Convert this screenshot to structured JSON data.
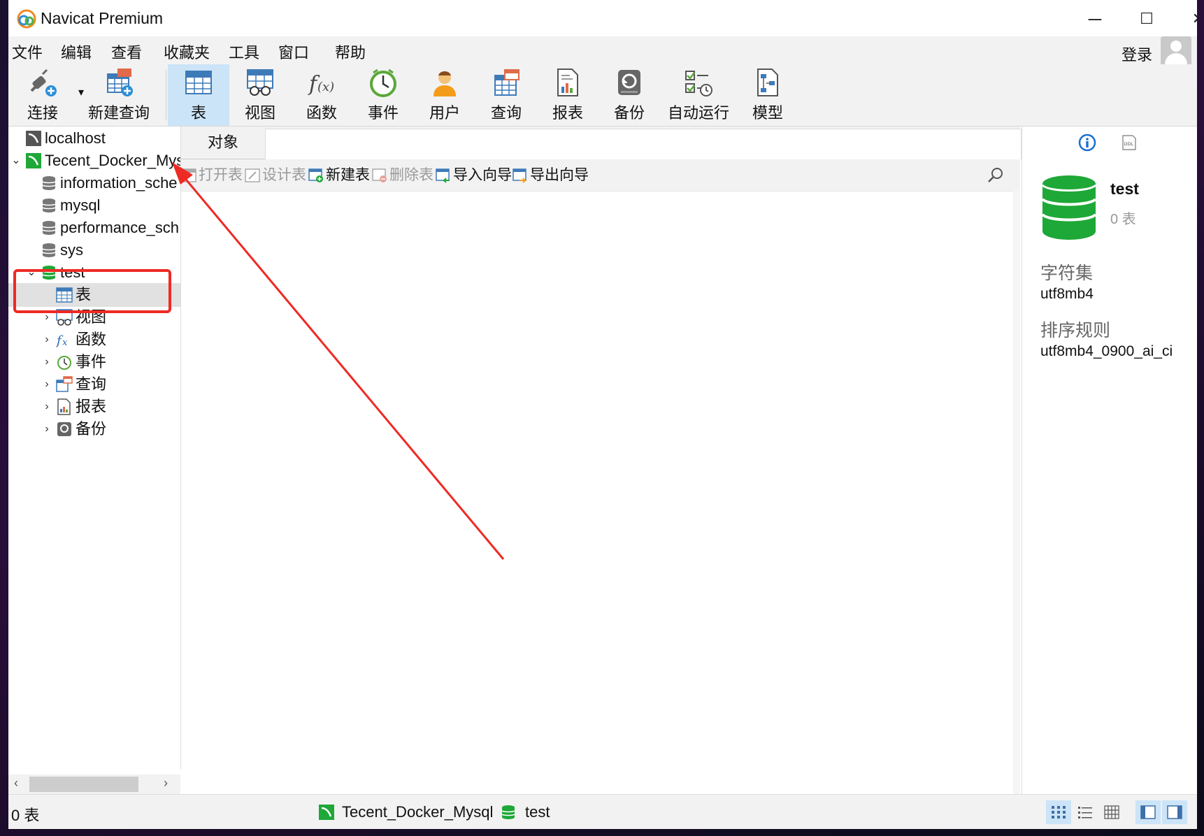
{
  "window": {
    "title": "Navicat Premium",
    "controls": {
      "minimize": "─",
      "maximize": "☐",
      "close": "✕"
    }
  },
  "menubar": {
    "items": [
      "文件",
      "编辑",
      "查看",
      "收藏夹",
      "工具",
      "窗口",
      "帮助"
    ],
    "login": "登录"
  },
  "toolbar": {
    "connect": "连接",
    "new_query": "新建查询",
    "buttons": [
      "表",
      "视图",
      "函数",
      "事件",
      "用户",
      "查询",
      "报表",
      "备份",
      "自动运行",
      "模型"
    ],
    "active": "表"
  },
  "sidebar": {
    "localhost": "localhost",
    "connection": "Tecent_Docker_Mys",
    "databases": [
      "information_sche",
      "mysql",
      "performance_sch",
      "sys"
    ],
    "open_db": "test",
    "children": [
      "表",
      "视图",
      "函数",
      "事件",
      "查询",
      "报表",
      "备份"
    ]
  },
  "main": {
    "tab": "对象",
    "actions": [
      "打开表",
      "设计表",
      "新建表",
      "删除表",
      "导入向导",
      "导出向导"
    ]
  },
  "info_panel": {
    "db_name": "test",
    "table_count": "0 表",
    "charset_label": "字符集",
    "charset_value": "utf8mb4",
    "collation_label": "排序规则",
    "collation_value": "utf8mb4_0900_ai_ci",
    "ddl_label": "DDL"
  },
  "status": {
    "count": "0 表",
    "connection": "Tecent_Docker_Mysql",
    "database": "test"
  },
  "colors": {
    "accent": "#cce4f7",
    "db_green": "#1ea837",
    "annotation": "#ee2a24"
  }
}
